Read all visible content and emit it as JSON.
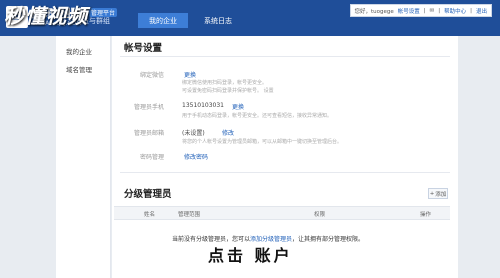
{
  "watermark": "秒懂视频",
  "brand": {
    "name_cn": "腾讯企业邮",
    "name_en": "EXMAIL.QQ.COM",
    "tag": "管理平台"
  },
  "nav": {
    "link_visible": "员与群组",
    "tabs": [
      "我的企业",
      "系统日志"
    ]
  },
  "userbar": {
    "greeting": "您好，tuogege",
    "account_link": "帐号设置",
    "sep": "|",
    "help_link": "帮助中心",
    "logout_link": "退出"
  },
  "sidebar": {
    "items": [
      "我的企业",
      "域名管理"
    ]
  },
  "account": {
    "title": "帐号设置",
    "fields": [
      {
        "label": "绑定微信",
        "action": "更换",
        "hints": [
          "绑定微信使用扫码登录，帐号更安全。",
          "可设置免密码扫码登录并保护帐号。 设置"
        ]
      },
      {
        "label": "管理员手机",
        "value": "13510103031",
        "action": "更换",
        "hints": [
          "用于手机动态码登录，帐号更安全。还可查看短信，接收异常通知。"
        ]
      },
      {
        "label": "管理员邮箱",
        "value": "(未设置)",
        "action": "修改",
        "hints": [
          "将您的个人帐号设置为管理员邮箱，可以从邮箱中一键切换至管理后台。"
        ]
      },
      {
        "label": "密码管理",
        "action": "修改密码"
      }
    ]
  },
  "admins": {
    "title": "分级管理员",
    "add_button": "添加",
    "columns": [
      "姓名",
      "管理范围",
      "权限",
      "操作"
    ],
    "empty_prefix": "当前没有分级管理员，您可以",
    "empty_link": "添加分级管理员",
    "empty_suffix": "，让其拥有部分管理权限。"
  },
  "caption": "点击 账户"
}
